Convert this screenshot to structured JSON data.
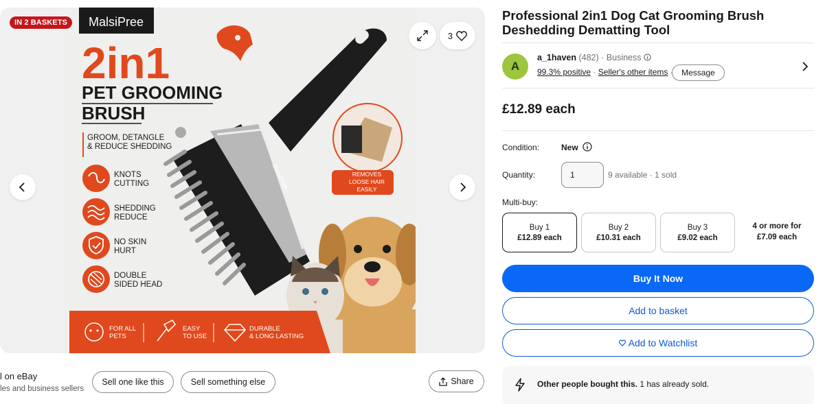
{
  "gallery": {
    "badge": "IN 2 BASKETS",
    "watch_count": "3",
    "product_image": {
      "brand": "MalsiPree",
      "headline": "2in1",
      "subhead_line1": "PET GROOMING",
      "subhead_line2": "BRUSH",
      "tagline_line1": "GROOM, DETANGLE",
      "tagline_line2": "& REDUCE SHEDDING",
      "features": [
        {
          "line1": "KNOTS",
          "line2": "CUTTING"
        },
        {
          "line1": "SHEDDING",
          "line2": "REDUCE"
        },
        {
          "line1": "NO SKIN",
          "line2": "HURT"
        },
        {
          "line1": "DOUBLE",
          "line2": "SIDED HEAD"
        }
      ],
      "callout_line1": "REMOVES",
      "callout_line2": "LOOSE HAIR",
      "callout_line3": "EASILY",
      "footer": [
        {
          "line1": "FOR ALL",
          "line2": "PETS"
        },
        {
          "line1": "EASY",
          "line2": "TO USE"
        },
        {
          "line1": "DURABLE",
          "line2": "& LONG LASTING"
        }
      ],
      "colors": {
        "accent": "#e0491d",
        "background": "#efefed",
        "dark": "#1a1a1a"
      }
    }
  },
  "sell_section": {
    "title": "l on eBay",
    "subtitle": "les and business sellers",
    "sell_one": "Sell one like this",
    "sell_else": "Sell something else",
    "share": "Share"
  },
  "listing": {
    "title": "Professional 2in1 Dog Cat Grooming Brush Deshedding Dematting Tool",
    "seller": {
      "avatar_letter": "A",
      "name": "a_1haven",
      "feedback": "(482)",
      "type": "· Business",
      "positive": "99.3% positive",
      "other_items": "Seller's other items",
      "message": "Message"
    },
    "price": "£12.89 each",
    "condition_label": "Condition:",
    "condition_value": "New",
    "quantity_label": "Quantity:",
    "quantity_value": "1",
    "quantity_note": "9 available · 1 sold",
    "multibuy_label": "Multi-buy:",
    "multibuy": [
      {
        "label": "Buy 1",
        "price": "£12.89 each"
      },
      {
        "label": "Buy 2",
        "price": "£10.31 each"
      },
      {
        "label": "Buy 3",
        "price": "£9.02 each"
      }
    ],
    "multibuy_more_line1": "4 or more for",
    "multibuy_more_line2": "£7.09 each",
    "buy_now": "Buy It Now",
    "add_basket": "Add to basket",
    "add_watchlist": "Add to Watchlist",
    "other_bought_bold": "Other people bought this.",
    "other_bought_rest": "1 has already sold."
  },
  "colors": {
    "primary_blue": "#0968f6",
    "link_blue": "#0b5ad1",
    "badge_red": "#c4161c",
    "avatar_green": "#9dc53e"
  }
}
